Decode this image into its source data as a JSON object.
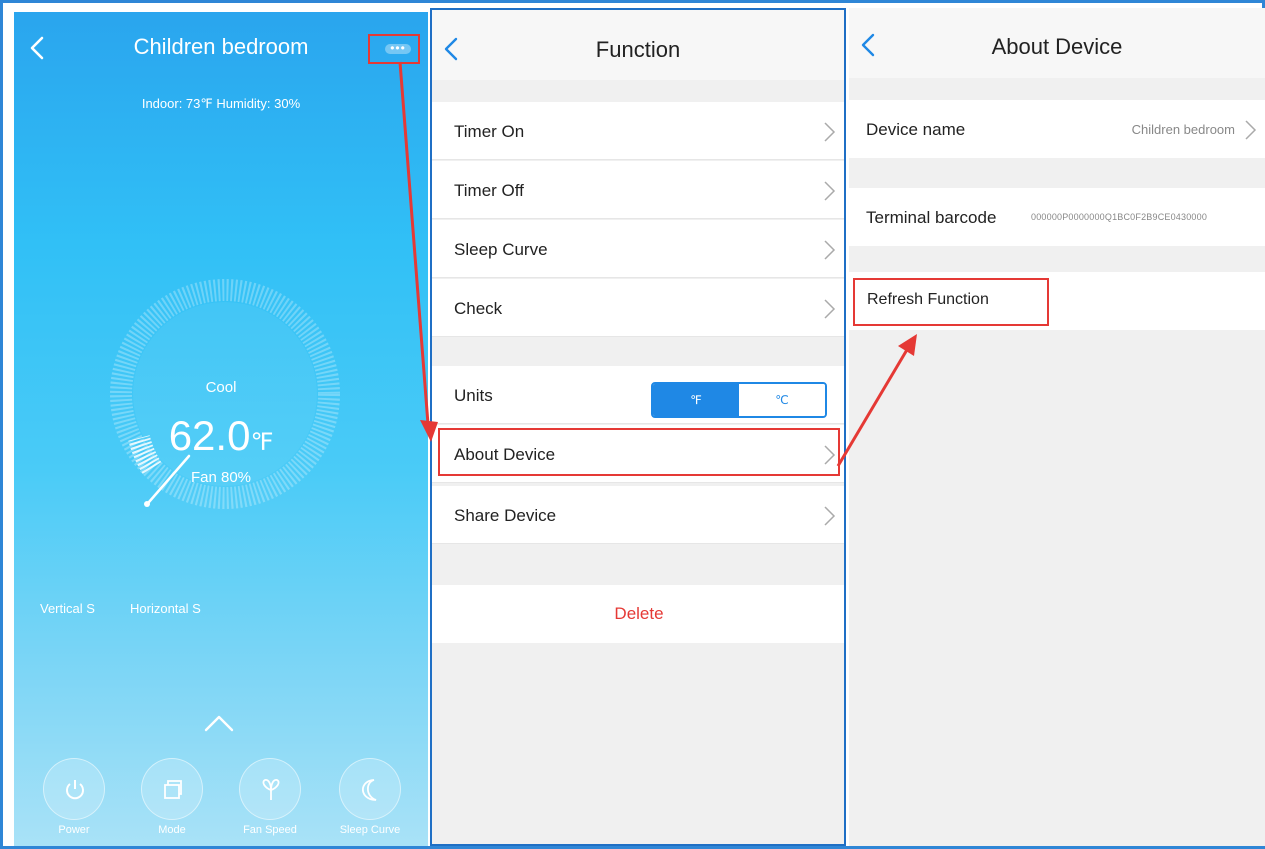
{
  "colors": {
    "frame": "#2f86d6",
    "highlight": "#e53935",
    "accent": "#1f88e5",
    "delete": "#e53935",
    "panel_bg": "#f0f0f0",
    "main_sky_top": "#2aa5ee",
    "main_sky_bottom": "#a9e2f7"
  },
  "panel_main": {
    "title": "Children bedroom",
    "more_icon": "ellipsis-icon",
    "indoor_info": "Indoor: 73℉ Humidity: 30%",
    "mode": "Cool",
    "temperature": "62.0",
    "temperature_unit": "℉",
    "fan": "Fan 80%",
    "swing_vertical": "Vertical S",
    "swing_horizontal": "Horizontal S",
    "controls": [
      {
        "label": "Power",
        "icon": "power-icon"
      },
      {
        "label": "Mode",
        "icon": "mode-icon"
      },
      {
        "label": "Fan Speed",
        "icon": "fan-icon"
      },
      {
        "label": "Sleep Curve",
        "icon": "moon-icon"
      }
    ]
  },
  "panel_function": {
    "title": "Function",
    "items": [
      {
        "label": "Timer On"
      },
      {
        "label": "Timer Off"
      },
      {
        "label": "Sleep Curve"
      },
      {
        "label": "Check"
      }
    ],
    "units": {
      "label": "Units",
      "option_f": "℉",
      "option_c": "℃",
      "selected": "℉"
    },
    "about_device": "About Device",
    "share_device": "Share Device",
    "delete": "Delete"
  },
  "panel_about": {
    "title": "About Device",
    "device_name_label": "Device name",
    "device_name_value": "Children bedroom",
    "terminal_barcode_label": "Terminal barcode",
    "terminal_barcode_value": "000000P0000000Q1BC0F2B9CE0430000",
    "refresh_function": "Refresh Function"
  }
}
